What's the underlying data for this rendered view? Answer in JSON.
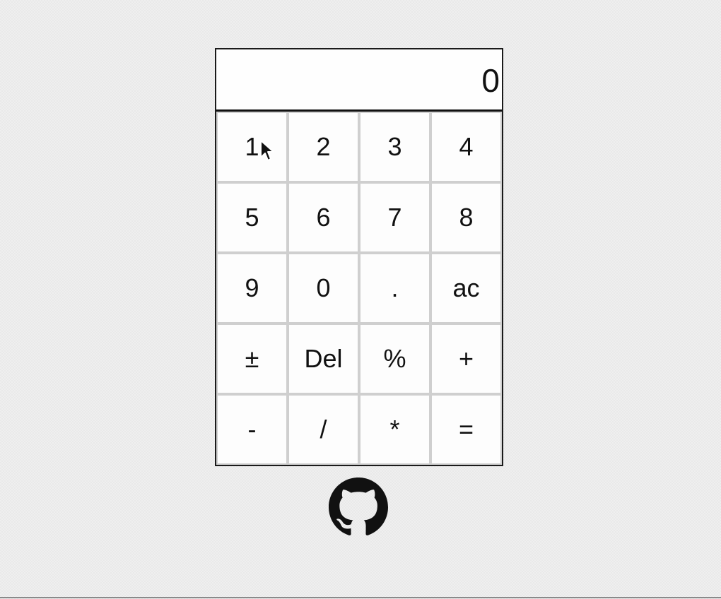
{
  "display": {
    "value": "0"
  },
  "keypad": {
    "keys": [
      {
        "label": "1",
        "name": "key-1"
      },
      {
        "label": "2",
        "name": "key-2"
      },
      {
        "label": "3",
        "name": "key-3"
      },
      {
        "label": "4",
        "name": "key-4"
      },
      {
        "label": "5",
        "name": "key-5"
      },
      {
        "label": "6",
        "name": "key-6"
      },
      {
        "label": "7",
        "name": "key-7"
      },
      {
        "label": "8",
        "name": "key-8"
      },
      {
        "label": "9",
        "name": "key-9"
      },
      {
        "label": "0",
        "name": "key-0"
      },
      {
        "label": ".",
        "name": "key-decimal"
      },
      {
        "label": "ac",
        "name": "key-all-clear"
      },
      {
        "label": "±",
        "name": "key-plus-minus"
      },
      {
        "label": "Del",
        "name": "key-delete"
      },
      {
        "label": "%",
        "name": "key-percent"
      },
      {
        "label": "+",
        "name": "key-add"
      },
      {
        "label": "-",
        "name": "key-subtract"
      },
      {
        "label": "/",
        "name": "key-divide"
      },
      {
        "label": "*",
        "name": "key-multiply"
      },
      {
        "label": "=",
        "name": "key-equals"
      }
    ]
  },
  "footer": {
    "link_icon": "github-icon"
  },
  "colors": {
    "page_background": "#efefef",
    "calculator_border": "#1a1a1a",
    "key_border": "#cfcfcf",
    "key_background": "#fdfdfd",
    "text": "#111111"
  }
}
